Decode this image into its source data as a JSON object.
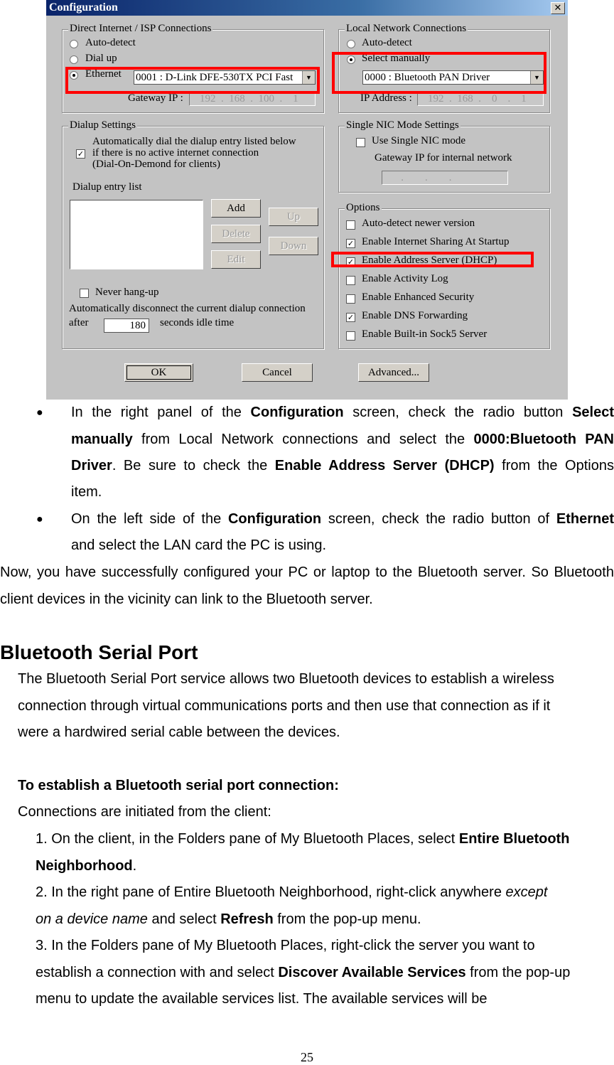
{
  "dialog": {
    "title": "Configuration",
    "close": "✕",
    "direct": {
      "legend": "Direct Internet / ISP  Connections",
      "auto": "Auto-detect",
      "dialup": "Dial up",
      "ethernet": "Ethernet",
      "adapter": "0001 : D-Link DFE-530TX PCI Fast",
      "gateway_label": "Gateway IP :",
      "gateway": "192  .  168  .  100  .    1"
    },
    "local": {
      "legend": "Local Network  Connections",
      "auto": "Auto-detect",
      "manual": "Select manually",
      "adapter": "0000 : Bluetooth PAN Driver",
      "ip_label": "IP Address :",
      "ip": "192  .  168  .    0    .    1"
    },
    "dialup": {
      "legend": "Dialup Settings",
      "auto_text": [
        "Automatically dial the dialup entry listed below",
        "if there is no active internet connection",
        "(Dial-On-Demond for clients)"
      ],
      "list_label": "Dialup entry list",
      "add": "Add",
      "delete": "Delete",
      "edit": "Edit",
      "up": "Up",
      "down": "Down",
      "never": "Never hang-up",
      "disconnect": "Automatically disconnect the current dialup connection",
      "after": "after",
      "idle_value": "180",
      "idle_unit": "seconds idle time"
    },
    "nic": {
      "legend": "Single NIC Mode Settings",
      "use": "Use Single NIC mode",
      "gw_label": "Gateway IP for internal network",
      "gw": "       .        .        ."
    },
    "options": {
      "legend": "Options",
      "items": [
        {
          "label": "Auto-detect newer version",
          "checked": false
        },
        {
          "label": "Enable Internet Sharing At Startup",
          "checked": true
        },
        {
          "label": "Enable Address Server (DHCP)",
          "checked": true
        },
        {
          "label": "Enable Activity Log",
          "checked": false
        },
        {
          "label": "Enable Enhanced Security",
          "checked": false
        },
        {
          "label": "Enable DNS Forwarding",
          "checked": true
        },
        {
          "label": "Enable Built-in Sock5 Server",
          "checked": false
        }
      ]
    },
    "ok": "OK",
    "cancel": "Cancel",
    "advanced": "Advanced..."
  },
  "bullets": {
    "symbol": "●",
    "b1": [
      "In the right panel of the ",
      "Configuration",
      " screen, check the radio button ",
      "Select",
      "manually",
      " from Local Network connections and select the ",
      "0000:Bluetooth PAN",
      "Driver",
      ". Be sure to check the ",
      "Enable Address Server (DHCP)",
      " from the Options",
      "item."
    ],
    "b2": [
      "On the left side of the ",
      "Configuration",
      " screen, check the radio button of ",
      "Ethernet",
      "and select the LAN card the PC is using."
    ]
  },
  "para1": [
    "Now, you have successfully configured your PC or laptop to the Bluetooth server. So Bluetooth",
    "client devices in the vicinity can link to the Bluetooth server."
  ],
  "heading": "Bluetooth Serial Port",
  "intro": [
    "The Bluetooth Serial Port service allows two Bluetooth devices to establish a wireless",
    "connection through virtual communications ports and then use that connection as if it",
    "were a hardwired serial cable between the devices."
  ],
  "subheading": "To establish a Bluetooth serial port connection:",
  "initiated": "Connections are initiated from the client:",
  "steps": {
    "s1": [
      "1. On the client, in the Folders pane of My Bluetooth Places, select ",
      "Entire Bluetooth",
      "Neighborhood",
      "."
    ],
    "s2": [
      "2. In the right pane of Entire Bluetooth Neighborhood, right-click anywhere ",
      "except",
      "on a device name",
      " and select ",
      "Refresh",
      " from the pop-up menu."
    ],
    "s3": [
      "3. In the Folders pane of My Bluetooth Places, right-click the server you want to",
      "establish a connection with and select ",
      "Discover Available Services",
      " from the pop-up",
      "menu to update the available services list. The available services will be"
    ]
  },
  "page_number": "25",
  "colors": {
    "highlight": "#ff0000",
    "titlebar": "#0a246a"
  }
}
